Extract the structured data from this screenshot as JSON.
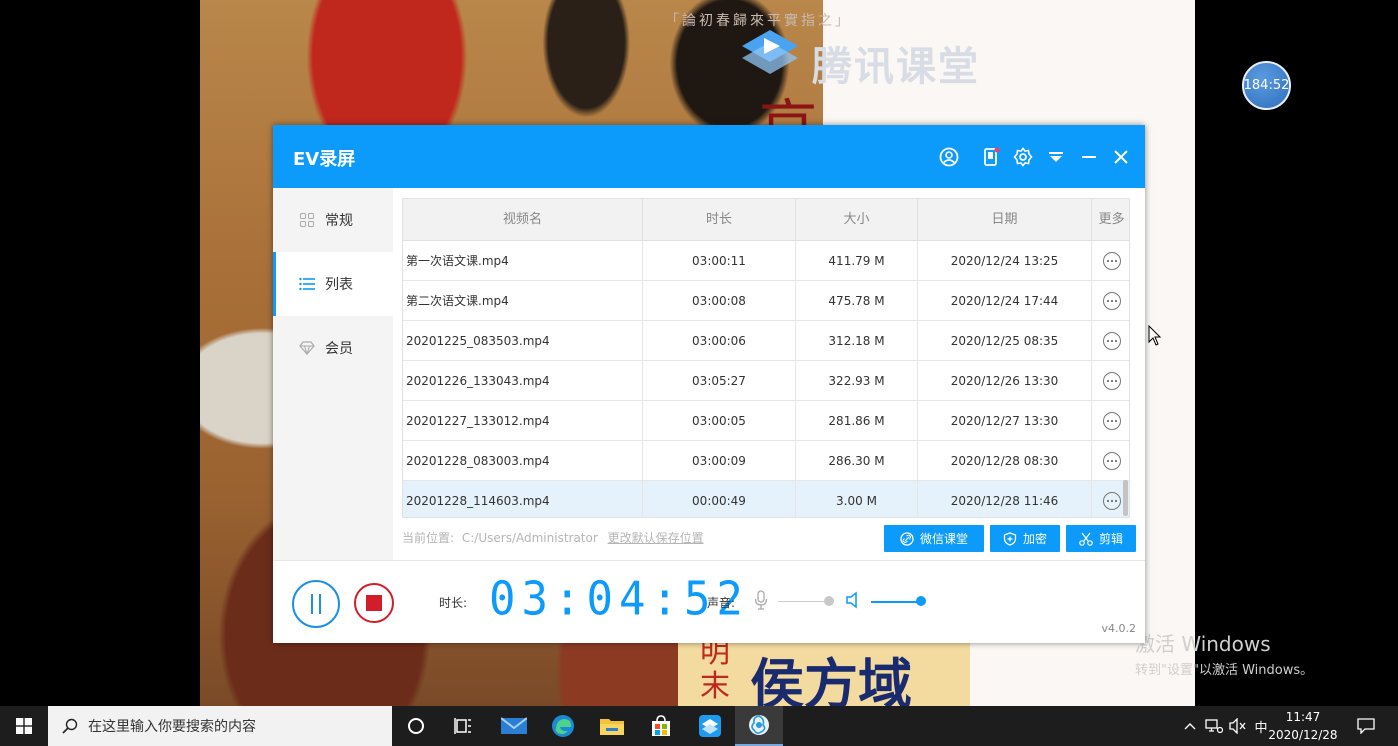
{
  "slide": {
    "brand": "腾讯课堂",
    "caption": "「論初春歸來平實指之」",
    "red_char": "哀",
    "dynasty": "明末",
    "author": "侯方域"
  },
  "overlay": {
    "timer": "184:52"
  },
  "window": {
    "title": "EV录屏"
  },
  "sidebar": {
    "items": [
      {
        "label": "常规",
        "icon": "grid-icon",
        "active": false
      },
      {
        "label": "列表",
        "icon": "list-icon",
        "active": true
      },
      {
        "label": "会员",
        "icon": "diamond-icon",
        "active": false
      }
    ]
  },
  "table": {
    "headers": [
      "视频名",
      "时长",
      "大小",
      "日期",
      "更多"
    ],
    "rows": [
      {
        "name": "第一次语文课.mp4",
        "duration": "03:00:11",
        "size": "411.79 M",
        "date": "2020/12/24 13:25"
      },
      {
        "name": "第二次语文课.mp4",
        "duration": "03:00:08",
        "size": "475.78 M",
        "date": "2020/12/24 17:44"
      },
      {
        "name": "20201225_083503.mp4",
        "duration": "03:00:06",
        "size": "312.18 M",
        "date": "2020/12/25 08:35"
      },
      {
        "name": "20201226_133043.mp4",
        "duration": "03:05:27",
        "size": "322.93 M",
        "date": "2020/12/26 13:30"
      },
      {
        "name": "20201227_133012.mp4",
        "duration": "03:00:05",
        "size": "281.86 M",
        "date": "2020/12/27 13:30"
      },
      {
        "name": "20201228_083003.mp4",
        "duration": "03:00:09",
        "size": "286.30 M",
        "date": "2020/12/28 08:30"
      },
      {
        "name": "20201228_114603.mp4",
        "duration": "00:00:49",
        "size": "3.00 M",
        "date": "2020/12/28 11:46"
      }
    ],
    "selected_index": 6
  },
  "path": {
    "label": "当前位置:",
    "value": "C:/Users/Administrator",
    "change": "更改默认保存位置"
  },
  "actions": {
    "wechat": "微信课堂",
    "encrypt": "加密",
    "cut": "剪辑"
  },
  "footer": {
    "duration_label": "时长:",
    "duration_value": "03:04:52",
    "sound_label": "声音:",
    "mic_level": 1.0,
    "speaker_level": 1.0,
    "version": "v4.0.2"
  },
  "activation": {
    "title": "激活 Windows",
    "subtitle": "转到\"设置\"以激活 Windows。"
  },
  "taskbar": {
    "search_placeholder": "在这里输入你要搜索的内容",
    "ime": "中",
    "time": "11:47",
    "date": "2020/12/28"
  },
  "colors": {
    "accent": "#0c9afb",
    "stop": "#d21d2a",
    "taskbar": "#1d1d1d"
  }
}
